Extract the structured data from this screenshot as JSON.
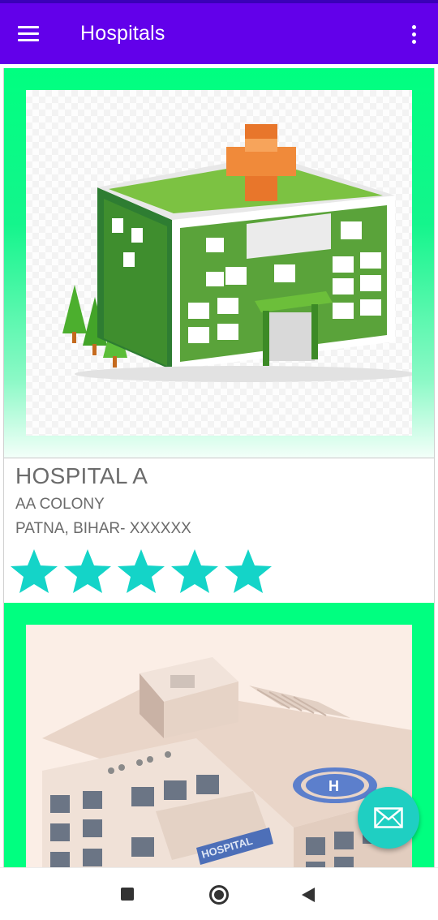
{
  "app_bar": {
    "title": "Hospitals",
    "menu_icon": "hamburger-menu-icon",
    "overflow_icon": "more-vert-icon",
    "color": "#6200ea"
  },
  "hospitals": [
    {
      "name": "HOSPITAL A",
      "address_line1": "AA COLONY",
      "address_line2": "PATNA, BIHAR- XXXXXX",
      "rating": 5,
      "image": "green-hospital-building-illustration"
    },
    {
      "image": "white-hospital-building-with-helipad-illustration",
      "image_sign_text": "HOSPITAL"
    }
  ],
  "colors": {
    "card_frame": "#00ff80",
    "star": "#14d4c8",
    "fab": "#1fcfc2",
    "text": "#6b6b6b"
  },
  "fab": {
    "icon": "mail-envelope-icon"
  },
  "nav_bar": {
    "recent_icon": "recent-apps-square-icon",
    "home_icon": "home-circle-icon",
    "back_icon": "back-triangle-icon"
  }
}
